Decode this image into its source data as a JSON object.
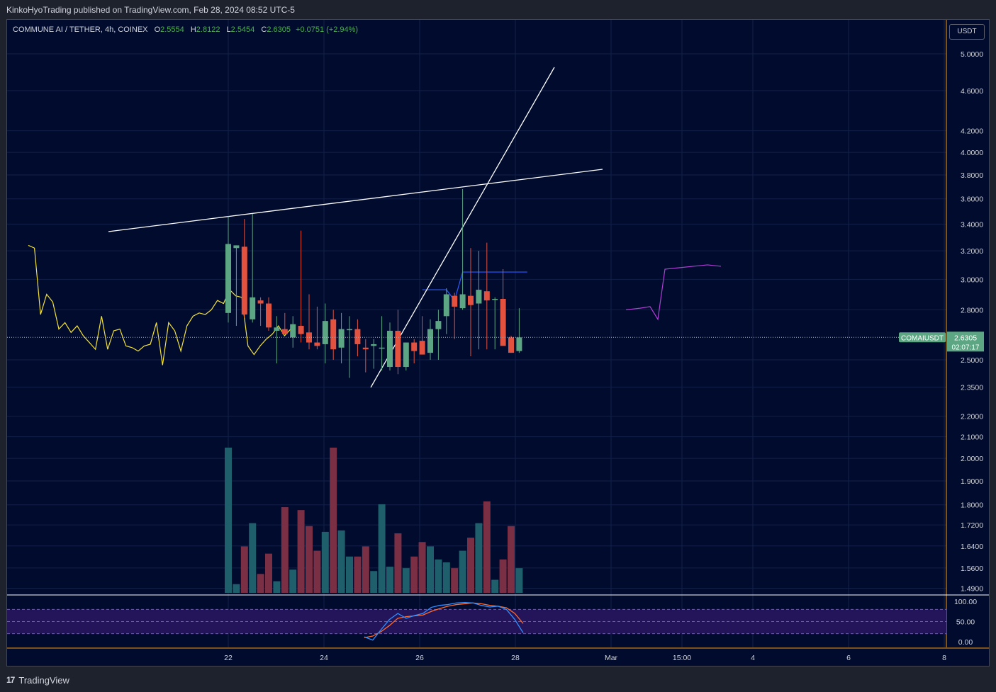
{
  "header": {
    "published": "KinkoHyoTrading published on TradingView.com, Feb 28, 2024 08:52 UTC-5"
  },
  "legend": {
    "symbol": "COMMUNE AI / TETHER, 4h, COINEX",
    "o_label": "O",
    "o": "2.5554",
    "h_label": "H",
    "h": "2.8122",
    "l_label": "L",
    "l": "2.5454",
    "c_label": "C",
    "c": "2.6305",
    "change": "+0.0751 (+2.94%)"
  },
  "currency_button": "USDT",
  "footer": {
    "logo": "17",
    "brand": "TradingView"
  },
  "colors": {
    "background": "#000b2e",
    "up": "#5da683",
    "down": "#e3513f",
    "vol_up": "#1f5f6b",
    "vol_down": "#7a2f45",
    "line_yellow": "#f5e33a",
    "line_blue": "#2e5bff",
    "line_purple": "#b13fd6",
    "stoch_k": "#2f8fff",
    "stoch_d": "#ff6a2b",
    "axis_accent": "#ff9800"
  },
  "chart_data": {
    "type": "candlestick",
    "title": "COMMUNE AI / TETHER, 4h, COINEX",
    "x_tick_labels": [
      "22",
      "24",
      "26",
      "28",
      "Mar",
      "15:00",
      "4",
      "6",
      "8"
    ],
    "price_scale": "log",
    "y_tick_labels": [
      "5.0000",
      "4.6000",
      "4.2000",
      "4.0000",
      "3.8000",
      "3.6000",
      "3.4000",
      "3.2000",
      "3.0000",
      "2.8000",
      "2.5000",
      "2.3500",
      "2.2000",
      "2.1000",
      "2.0000",
      "1.9000",
      "1.8000",
      "1.7200",
      "1.6400",
      "1.5600",
      "1.4900"
    ],
    "last_price": {
      "symbol": "COMAIUSDT",
      "price": "2.6305",
      "countdown": "02:07:17"
    },
    "candles": [
      {
        "o": 2.78,
        "h": 3.46,
        "l": 2.72,
        "c": 3.25
      },
      {
        "o": 3.22,
        "h": 3.24,
        "l": 2.7,
        "c": 3.24
      },
      {
        "o": 3.23,
        "h": 3.44,
        "l": 2.75,
        "c": 2.77
      },
      {
        "o": 2.74,
        "h": 3.48,
        "l": 2.72,
        "c": 2.88
      },
      {
        "o": 2.86,
        "h": 2.88,
        "l": 2.7,
        "c": 2.84
      },
      {
        "o": 2.84,
        "h": 2.88,
        "l": 2.67,
        "c": 2.69
      },
      {
        "o": 2.67,
        "h": 2.76,
        "l": 2.48,
        "c": 2.69
      },
      {
        "o": 2.68,
        "h": 2.78,
        "l": 2.65,
        "c": 2.65
      },
      {
        "o": 2.63,
        "h": 2.76,
        "l": 2.57,
        "c": 2.71
      },
      {
        "o": 2.7,
        "h": 3.35,
        "l": 2.6,
        "c": 2.65
      },
      {
        "o": 2.66,
        "h": 2.9,
        "l": 2.56,
        "c": 2.6
      },
      {
        "o": 2.6,
        "h": 2.82,
        "l": 2.56,
        "c": 2.58
      },
      {
        "o": 2.59,
        "h": 2.84,
        "l": 2.48,
        "c": 2.73
      },
      {
        "o": 2.74,
        "h": 2.8,
        "l": 2.5,
        "c": 2.56
      },
      {
        "o": 2.57,
        "h": 2.78,
        "l": 2.48,
        "c": 2.68
      },
      {
        "o": 2.68,
        "h": 2.76,
        "l": 2.4,
        "c": 2.68
      },
      {
        "o": 2.68,
        "h": 2.74,
        "l": 2.52,
        "c": 2.59
      },
      {
        "o": 2.57,
        "h": 2.62,
        "l": 2.43,
        "c": 2.56
      },
      {
        "o": 2.58,
        "h": 2.62,
        "l": 2.45,
        "c": 2.59
      },
      {
        "o": 2.57,
        "h": 2.76,
        "l": 2.44,
        "c": 2.57
      },
      {
        "o": 2.46,
        "h": 2.72,
        "l": 2.44,
        "c": 2.67
      },
      {
        "o": 2.67,
        "h": 2.8,
        "l": 2.42,
        "c": 2.46
      },
      {
        "o": 2.46,
        "h": 2.6,
        "l": 2.44,
        "c": 2.6
      },
      {
        "o": 2.6,
        "h": 2.62,
        "l": 2.48,
        "c": 2.55
      },
      {
        "o": 2.61,
        "h": 2.76,
        "l": 2.53,
        "c": 2.53
      },
      {
        "o": 2.54,
        "h": 2.74,
        "l": 2.5,
        "c": 2.68
      },
      {
        "o": 2.68,
        "h": 2.8,
        "l": 2.5,
        "c": 2.73
      },
      {
        "o": 2.76,
        "h": 2.94,
        "l": 2.65,
        "c": 2.9
      },
      {
        "o": 2.89,
        "h": 2.91,
        "l": 2.62,
        "c": 2.82
      },
      {
        "o": 2.81,
        "h": 3.68,
        "l": 2.8,
        "c": 2.9
      },
      {
        "o": 2.89,
        "h": 3.22,
        "l": 2.52,
        "c": 2.83
      },
      {
        "o": 2.84,
        "h": 3.2,
        "l": 2.56,
        "c": 2.93
      },
      {
        "o": 2.92,
        "h": 3.26,
        "l": 2.56,
        "c": 2.86
      },
      {
        "o": 2.87,
        "h": 2.88,
        "l": 2.56,
        "c": 2.87
      },
      {
        "o": 2.87,
        "h": 3.07,
        "l": 2.58,
        "c": 2.58
      },
      {
        "o": 2.63,
        "h": 2.64,
        "l": 2.54,
        "c": 2.54
      },
      {
        "o": 2.55,
        "h": 2.81,
        "l": 2.54,
        "c": 2.63
      }
    ],
    "volume_relative": [
      1.0,
      0.06,
      0.32,
      0.48,
      0.13,
      0.27,
      0.08,
      0.59,
      0.16,
      0.57,
      0.46,
      0.29,
      0.42,
      1.0,
      0.43,
      0.25,
      0.25,
      0.32,
      0.15,
      0.61,
      0.18,
      0.41,
      0.17,
      0.25,
      0.35,
      0.32,
      0.23,
      0.21,
      0.17,
      0.29,
      0.38,
      0.48,
      0.63,
      0.09,
      0.23,
      0.46,
      0.17
    ],
    "yellow_line": [
      3.24,
      3.22,
      2.77,
      2.9,
      2.85,
      2.68,
      2.72,
      2.66,
      2.7,
      2.64,
      2.6,
      2.56,
      2.76,
      2.56,
      2.67,
      2.68,
      2.58,
      2.57,
      2.55,
      2.58,
      2.59,
      2.72,
      2.47,
      2.72,
      2.67,
      2.55,
      2.7,
      2.76,
      2.78,
      2.77,
      2.8,
      2.86,
      2.84,
      2.93,
      2.89,
      2.88,
      2.58,
      2.53,
      2.58,
      2.62,
      2.65,
      2.7,
      2.64,
      2.68
    ],
    "purple_line": [
      2.8,
      2.81,
      2.82,
      2.74,
      3.07,
      3.08,
      3.09,
      3.1,
      3.09
    ],
    "stoch_rsi": {
      "levels": [
        "100.00",
        "50.00",
        "0.00"
      ],
      "k": [
        12,
        4,
        30,
        55,
        70,
        58,
        65,
        70,
        85,
        90,
        92,
        96,
        97,
        96,
        90,
        86,
        88,
        80,
        55,
        22
      ],
      "d": [
        10,
        14,
        25,
        40,
        58,
        62,
        64,
        66,
        75,
        82,
        88,
        92,
        94,
        96,
        94,
        90,
        88,
        84,
        70,
        45
      ]
    }
  }
}
